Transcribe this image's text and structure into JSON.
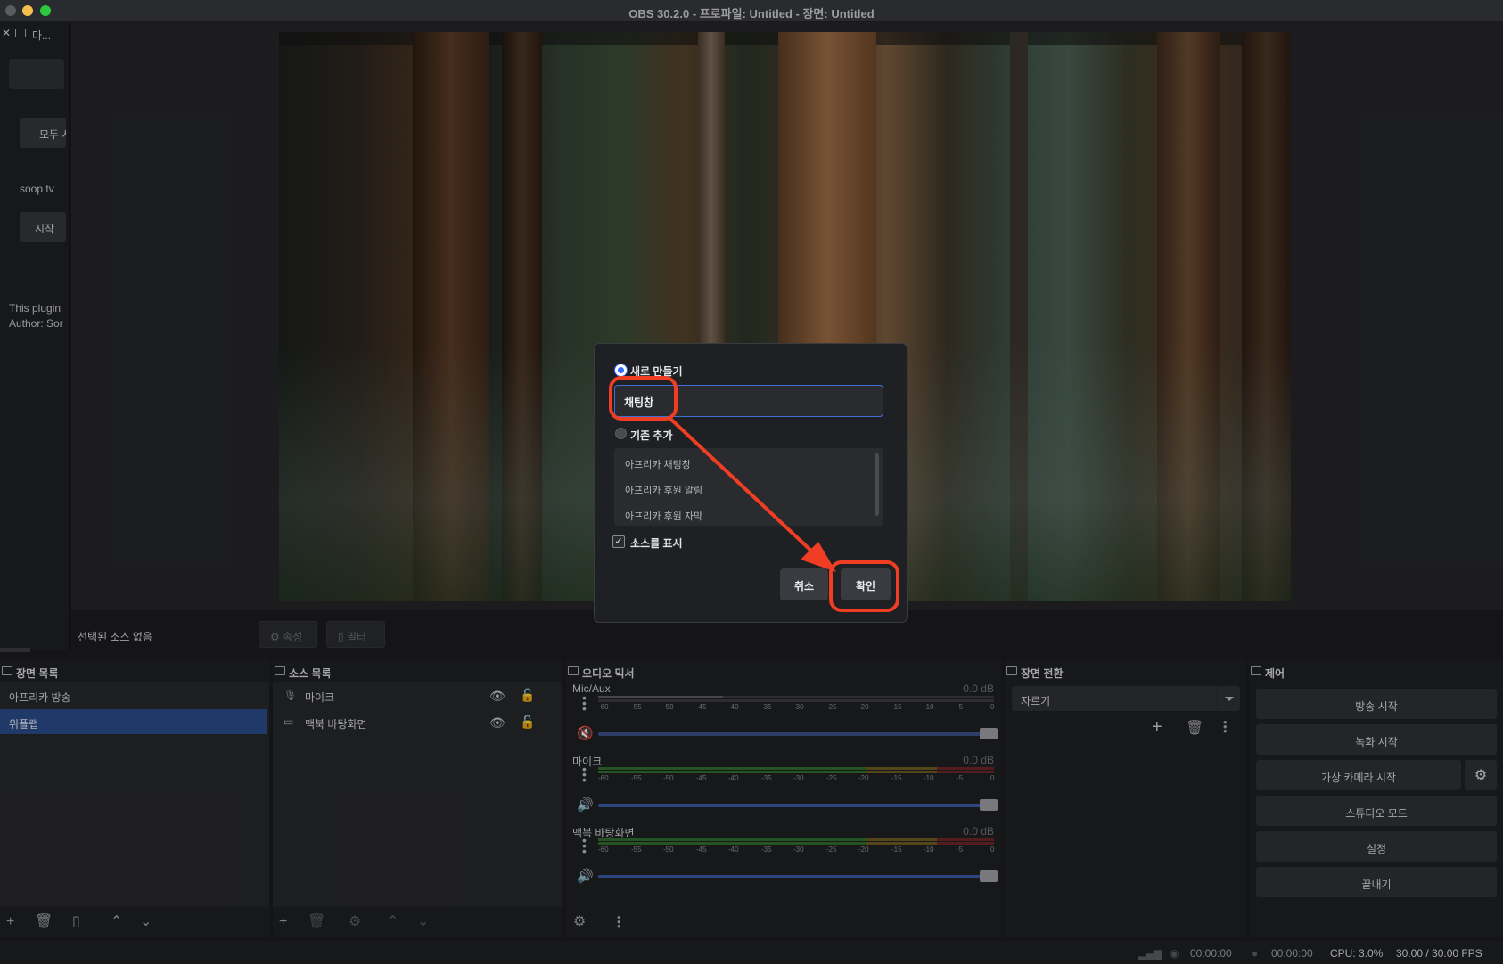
{
  "window": {
    "title": "OBS 30.2.0 - 프로파일: Untitled - 장면: Untitled"
  },
  "left_dock": {
    "title": "다...",
    "button1": "모두 시",
    "service_label": "soop tv",
    "start_button": "시작",
    "info_line1": "This plugin",
    "info_line2": "Author: Sor"
  },
  "props_bar": {
    "no_source": "선택된 소스 없음",
    "properties": "속성",
    "filters": "필터"
  },
  "scenes": {
    "title": "장면 목록",
    "items": [
      "아프리카 방송",
      "위플랩"
    ],
    "selected": "위플랩"
  },
  "sources": {
    "title": "소스 목록",
    "items": [
      {
        "name": "마이크",
        "icon": "microphone-icon"
      },
      {
        "name": "맥북 바탕화면",
        "icon": "monitor-icon"
      }
    ]
  },
  "mixer": {
    "title": "오디오 믹서",
    "scale": [
      "-60",
      "-55",
      "-50",
      "-45",
      "-40",
      "-35",
      "-30",
      "-25",
      "-20",
      "-15",
      "-10",
      "-5",
      "0"
    ],
    "channels": [
      {
        "name": "Mic/Aux",
        "db": "0.0 dB",
        "muted": true
      },
      {
        "name": "마이크",
        "db": "0.0 dB",
        "muted": false
      },
      {
        "name": "맥북 바탕화면",
        "db": "0.0 dB",
        "muted": false
      }
    ]
  },
  "transitions": {
    "title": "장면 전환",
    "selected": "자르기"
  },
  "controls": {
    "title": "제어",
    "buttons": [
      "방송 시작",
      "녹화 시작",
      "가상 카메라 시작",
      "스튜디오 모드",
      "설정",
      "끝내기"
    ]
  },
  "status": {
    "stream_time": "00:00:00",
    "rec_time": "00:00:00",
    "cpu": "CPU: 3.0%",
    "fps": "30.00 / 30.00 FPS"
  },
  "dialog": {
    "create_new_label": "새로 만들기",
    "name_value": "채팅창",
    "add_existing_label": "기존 추가",
    "existing_items": [
      "아프리카 채팅창",
      "아프리카 후원 알림",
      "아프리카 후원 자막"
    ],
    "visible_label": "소스를 표시",
    "visible_checked": true,
    "cancel": "취소",
    "ok": "확인"
  },
  "colors": {
    "accent": "#2f6bff",
    "selection": "#284a86",
    "annotation": "#ef3e23",
    "muted": "#d43a3a"
  }
}
